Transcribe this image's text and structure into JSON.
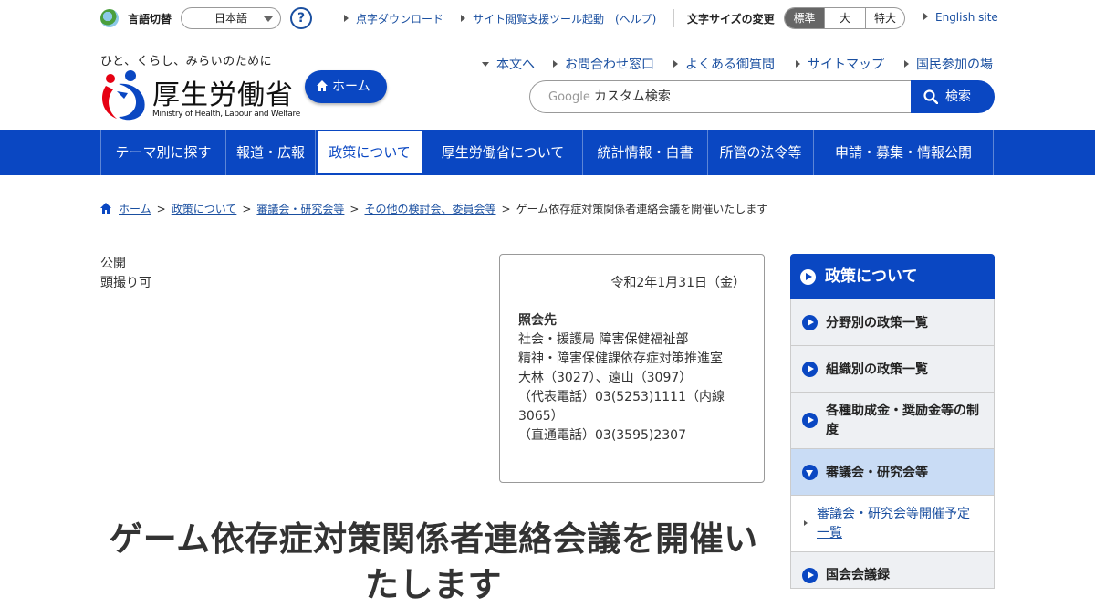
{
  "topbar": {
    "language_label": "言語切替",
    "language_value": "日本語",
    "help": "?",
    "links": [
      "点字ダウンロード",
      "サイト閲覧支援ツール起動　(ヘルプ)"
    ],
    "font_size_label": "文字サイズの変更",
    "font_sizes": [
      "標準",
      "大",
      "特大"
    ],
    "english": "English site"
  },
  "header": {
    "tagline": "ひと、くらし、みらいのために",
    "logo_name": "厚生労働省",
    "logo_en": "Ministry of Health, Labour and Welfare",
    "home_button": "ホーム",
    "links": [
      "本文へ",
      "お問合わせ窓口",
      "よくある御質問",
      "サイトマップ",
      "国民参加の場"
    ],
    "search_brand": "Google",
    "search_text": "カスタム検索",
    "search_button": "検索"
  },
  "gnav": [
    "テーマ別に探す",
    "報道・広報",
    "政策について",
    "厚生労働省について",
    "統計情報・白書",
    "所管の法令等",
    "申請・募集・情報公開"
  ],
  "breadcrumb": {
    "links": [
      "ホーム",
      "政策について",
      "審議会・研究会等",
      "その他の検討会、委員会等"
    ],
    "current": "ゲーム依存症対策関係者連絡会議を開催いたします",
    "separator": ">"
  },
  "meta": [
    "公開",
    "頭撮り可"
  ],
  "contact": {
    "date": "令和2年1月31日（金）",
    "title": "照会先",
    "lines": [
      "社会・援護局 障害保健福祉部",
      "精神・障害保健課依存症対策推進室",
      "大林（3027）、遠山（3097）",
      "（代表電話）03(5253)1111（内線3065）",
      "（直通電話）03(3595)2307"
    ]
  },
  "title": "ゲーム依存症対策関係者連絡会議を開催いたします",
  "side": {
    "heading": "政策について",
    "items": [
      "分野別の政策一覧",
      "組織別の政策一覧",
      "各種助成金・奨励金等の制度",
      "審議会・研究会等"
    ],
    "sub_items": [
      "審議会・研究会等開催予定一覧"
    ],
    "next_item": "国会会議録"
  },
  "colors": {
    "brand_blue": "#0a47c2",
    "link_blue": "#1a4fa0"
  }
}
